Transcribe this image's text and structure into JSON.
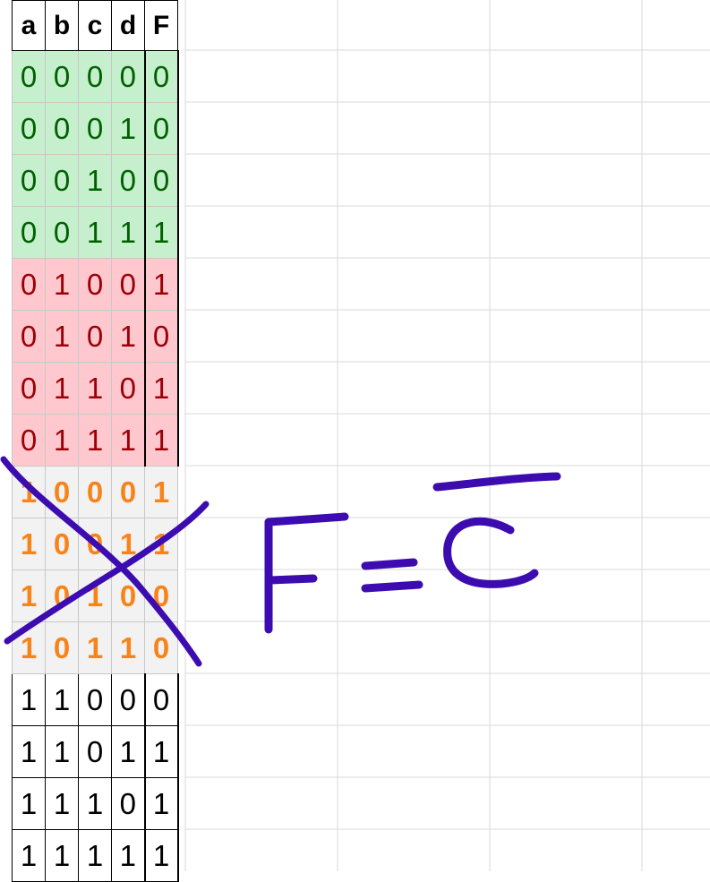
{
  "table": {
    "headers": [
      "a",
      "b",
      "c",
      "d",
      "F"
    ],
    "rows": [
      {
        "group": "green",
        "cells": [
          "0",
          "0",
          "0",
          "0",
          "0"
        ]
      },
      {
        "group": "green",
        "cells": [
          "0",
          "0",
          "0",
          "1",
          "0"
        ]
      },
      {
        "group": "green",
        "cells": [
          "0",
          "0",
          "1",
          "0",
          "0"
        ]
      },
      {
        "group": "green",
        "cells": [
          "0",
          "0",
          "1",
          "1",
          "1"
        ]
      },
      {
        "group": "red",
        "cells": [
          "0",
          "1",
          "0",
          "0",
          "1"
        ]
      },
      {
        "group": "red",
        "cells": [
          "0",
          "1",
          "0",
          "1",
          "0"
        ]
      },
      {
        "group": "red",
        "cells": [
          "0",
          "1",
          "1",
          "0",
          "1"
        ]
      },
      {
        "group": "red",
        "cells": [
          "0",
          "1",
          "1",
          "1",
          "1"
        ]
      },
      {
        "group": "orange",
        "cells": [
          "1",
          "0",
          "0",
          "0",
          "1"
        ]
      },
      {
        "group": "orange",
        "cells": [
          "1",
          "0",
          "0",
          "1",
          "1"
        ]
      },
      {
        "group": "orange",
        "cells": [
          "1",
          "0",
          "1",
          "0",
          "0"
        ]
      },
      {
        "group": "orange",
        "cells": [
          "1",
          "0",
          "1",
          "1",
          "0"
        ]
      },
      {
        "group": "white",
        "cells": [
          "1",
          "1",
          "0",
          "0",
          "0"
        ]
      },
      {
        "group": "white",
        "cells": [
          "1",
          "1",
          "0",
          "1",
          "1"
        ]
      },
      {
        "group": "white",
        "cells": [
          "1",
          "1",
          "1",
          "0",
          "1"
        ]
      },
      {
        "group": "white",
        "cells": [
          "1",
          "1",
          "1",
          "1",
          "1"
        ]
      }
    ]
  },
  "annotation": {
    "formula_lhs": "F",
    "formula_eq": "=",
    "formula_rhs": "C",
    "rhs_overbar": true,
    "crossed_out_group": "orange",
    "ink_color": "#3d0cb0"
  },
  "colors": {
    "green_fill": "#c6efce",
    "green_text": "#006100",
    "red_fill": "#ffc7ce",
    "red_text": "#9c0006",
    "orange_fill": "#f2f2f2",
    "orange_text": "#f7841b",
    "gridline": "#d9d9d9"
  }
}
